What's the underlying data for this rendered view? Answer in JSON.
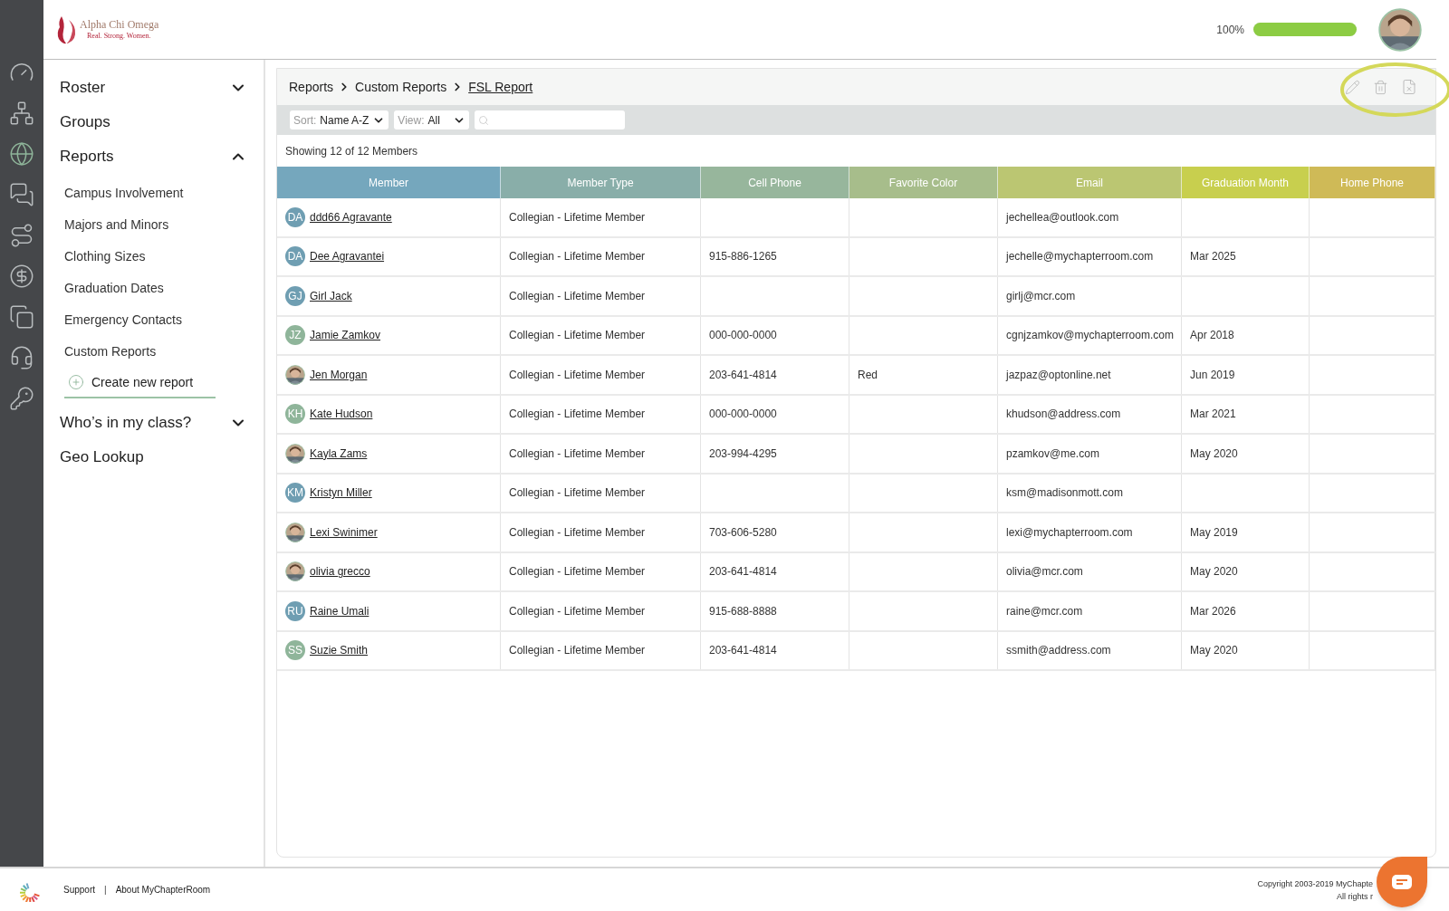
{
  "logo": {
    "name": "Alpha Chi Omega",
    "tagline": "Real. Strong. Women."
  },
  "profile": {
    "progress_label": "100%",
    "level": 1
  },
  "rail_items": [
    {
      "selected": false
    },
    {
      "selected": false
    },
    {
      "selected": true
    },
    {
      "selected": false
    },
    {
      "selected": false
    },
    {
      "selected": false
    },
    {
      "selected": false
    },
    {
      "selected": false
    },
    {
      "selected": false
    }
  ],
  "sidebar": {
    "items": [
      {
        "label": "Roster",
        "expandable": true,
        "expanded": false
      },
      {
        "label": "Groups",
        "expandable": false
      },
      {
        "label": "Reports",
        "expandable": true,
        "expanded": true,
        "children": [
          {
            "kind": "link",
            "label": "Campus Involvement"
          },
          {
            "kind": "link",
            "label": "Majors and Minors"
          },
          {
            "kind": "link",
            "label": "Clothing Sizes"
          },
          {
            "kind": "link",
            "label": "Graduation Dates"
          },
          {
            "kind": "link",
            "label": "Emergency Contacts"
          },
          {
            "kind": "link",
            "label": "Custom Reports"
          },
          {
            "kind": "action",
            "label": "Create new report"
          }
        ]
      },
      {
        "label": "Who’s in my class?",
        "expandable": true,
        "expanded": false
      },
      {
        "label": "Geo Lookup",
        "expandable": false
      }
    ]
  },
  "breadcrumb": [
    {
      "label": "Reports",
      "current": false
    },
    {
      "label": "Custom Reports",
      "current": false
    },
    {
      "label": "FSL Report",
      "current": true
    }
  ],
  "filters": {
    "sort": {
      "label": "Sort:",
      "value": "Name A-Z"
    },
    "view": {
      "label": "View:",
      "value": "All"
    }
  },
  "summary": "Showing 12 of 12 Members",
  "table": {
    "columns": [
      {
        "label": "Member",
        "color": "#75a7bd"
      },
      {
        "label": "Member Type",
        "color": "#89aea9"
      },
      {
        "label": "Cell Phone",
        "color": "#97b69c"
      },
      {
        "label": "Favorite Color",
        "color": "#a7bd8b"
      },
      {
        "label": "Email",
        "color": "#bbc672"
      },
      {
        "label": "Graduation Month",
        "color": "#c8cf4e"
      },
      {
        "label": "Home Phone",
        "color": "#cfba57"
      }
    ],
    "rows": [
      {
        "avatar": {
          "kind": "initials",
          "text": "DA",
          "color": "#6f9eb2"
        },
        "member": "ddd66 Agravante",
        "member_type": "Collegian - Lifetime Member",
        "email": "jechellea@outlook.com"
      },
      {
        "avatar": {
          "kind": "initials",
          "text": "DA",
          "color": "#6f9eb2"
        },
        "member": "Dee Agravantei",
        "member_type": "Collegian - Lifetime Member",
        "cell_phone": "915-886-1265",
        "email": "jechelle@mychapterroom.com",
        "graduation_month": "Mar 2025"
      },
      {
        "avatar": {
          "kind": "initials",
          "text": "GJ",
          "color": "#6f9eb2"
        },
        "member": "Girl Jack",
        "member_type": "Collegian - Lifetime Member",
        "email": "girlj@mcr.com"
      },
      {
        "avatar": {
          "kind": "initials",
          "text": "JZ",
          "color": "#8fb59a"
        },
        "member": "Jamie Zamkov",
        "member_type": "Collegian - Lifetime Member",
        "cell_phone": "000-000-0000",
        "email": "cgnjzamkov@mychapterroom.com",
        "graduation_month": "Apr 2018"
      },
      {
        "member": "Jen Morgan",
        "member_type": "Collegian - Lifetime Member",
        "cell_phone": "203-641-4814",
        "favorite_color": "Red",
        "email": "jazpaz@optonline.net",
        "graduation_month": "Jun 2019"
      },
      {
        "avatar": {
          "kind": "initials",
          "text": "KH",
          "color": "#8fb59a"
        },
        "member": "Kate Hudson",
        "member_type": "Collegian - Lifetime Member",
        "cell_phone": "000-000-0000",
        "email": "khudson@address.com",
        "graduation_month": "Mar 2021"
      },
      {
        "member": "Kayla Zams",
        "member_type": "Collegian - Lifetime Member",
        "cell_phone": "203-994-4295",
        "email": "pzamkov@me.com",
        "graduation_month": "May 2020"
      },
      {
        "avatar": {
          "kind": "initials",
          "text": "KM",
          "color": "#6f9eb2"
        },
        "member": "Kristyn Miller",
        "member_type": "Collegian - Lifetime Member",
        "email": "ksm@madisonmott.com"
      },
      {
        "member": "Lexi Swinimer",
        "member_type": "Collegian - Lifetime Member",
        "cell_phone": "703-606-5280",
        "email": "lexi@mychapterroom.com",
        "graduation_month": "May 2019"
      },
      {
        "member": "olivia grecco",
        "member_type": "Collegian - Lifetime Member",
        "cell_phone": "203-641-4814",
        "email": "olivia@mcr.com",
        "graduation_month": "May 2020"
      },
      {
        "avatar": {
          "kind": "initials",
          "text": "RU",
          "color": "#6f9eb2"
        },
        "member": "Raine Umali",
        "member_type": "Collegian - Lifetime Member",
        "cell_phone": "915-688-8888",
        "email": "raine@mcr.com",
        "graduation_month": "Mar 2026"
      },
      {
        "avatar": {
          "kind": "initials",
          "text": "SS",
          "color": "#8fb59a"
        },
        "member": "Suzie Smith",
        "member_type": "Collegian - Lifetime Member",
        "cell_phone": "203-641-4814",
        "email": "ssmith@address.com",
        "graduation_month": "May 2020"
      }
    ]
  },
  "footer": {
    "links": [
      "Support",
      "About MyChapterRoom"
    ],
    "separator": "|",
    "copyright": [
      "Copyright 2003-2019 MyChapte",
      "All rights r"
    ]
  }
}
